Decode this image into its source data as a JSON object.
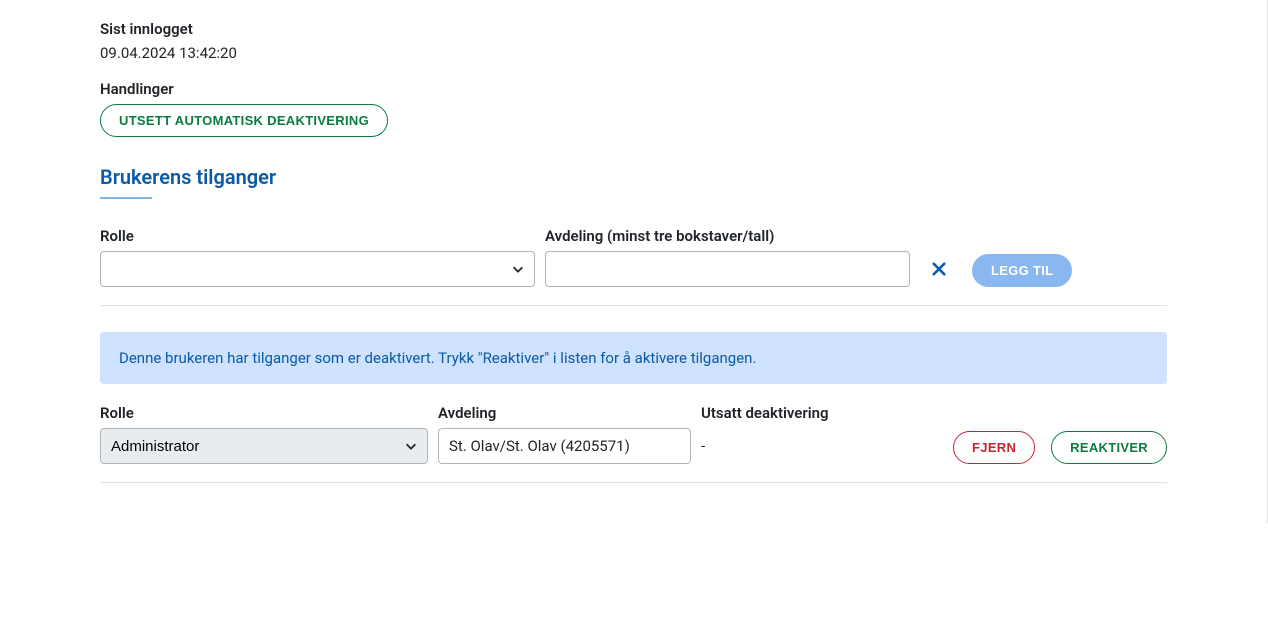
{
  "last_login": {
    "label": "Sist innlogget",
    "value": "09.04.2024 13:42:20"
  },
  "actions": {
    "label": "Handlinger",
    "postpone_button": "UTSETT AUTOMATISK DEAKTIVERING"
  },
  "access_section": {
    "heading": "Brukerens tilganger",
    "role_label": "Rolle",
    "department_label": "Avdeling (minst tre bokstaver/tall)",
    "add_button": "LEGG TIL",
    "role_value": "",
    "department_value": ""
  },
  "alert": {
    "message": "Denne brukeren har tilganger som er deaktivert. Trykk \"Reaktiver\" i listen for å aktivere tilgangen."
  },
  "table": {
    "headers": {
      "role": "Rolle",
      "department": "Avdeling",
      "postponed": "Utsatt deaktivering"
    },
    "row": {
      "role": "Administrator",
      "department": "St. Olav/St. Olav (4205571)",
      "postponed": "-"
    },
    "remove_button": "FJERN",
    "reactivate_button": "REAKTIVER"
  }
}
